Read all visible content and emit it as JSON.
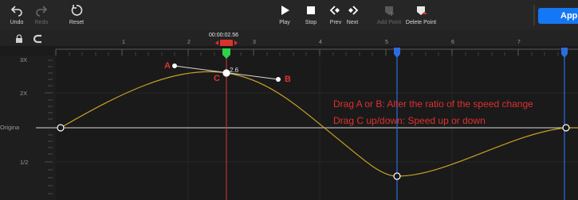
{
  "toolbar": {
    "undo": "Undo",
    "redo": "Redo",
    "reset": "Reset",
    "play": "Play",
    "stop": "Stop",
    "prev": "Prev",
    "next": "Next",
    "add_point": "Add Point",
    "delete_point": "Delete Point",
    "apply": "Appl"
  },
  "timeline": {
    "current_time": "00:00:02.56",
    "ruler_labels": [
      "1",
      "2",
      "3",
      "4",
      "5",
      "6",
      "7"
    ]
  },
  "graph": {
    "y_labels": [
      "3X",
      "2X",
      "Origina",
      "1/2"
    ],
    "point_value": "2.6",
    "markers": {
      "a": "A",
      "b": "B",
      "c": "C"
    }
  },
  "help": {
    "line1": "Drag A or B: Alter the ratio of the speed change",
    "line2": "Drag C up/down: Speed up or down"
  },
  "colors": {
    "accent": "#1677f5",
    "curve": "#c9a227",
    "playhead": "#e03030",
    "marker_blue": "#2a6de0",
    "annotation": "#e03030"
  }
}
